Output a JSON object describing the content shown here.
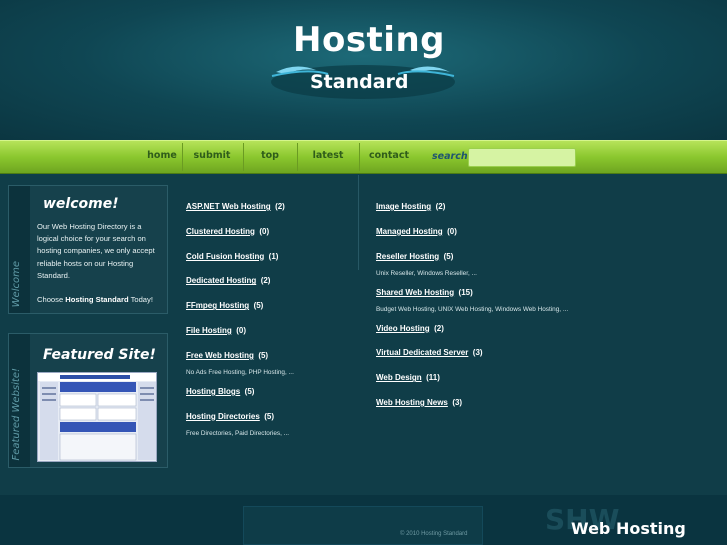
{
  "header": {
    "logo_title": "Hosting",
    "logo_subtitle": "Standard"
  },
  "nav": {
    "items": [
      "home",
      "submit link",
      "top links",
      "latest links",
      "contact us"
    ],
    "search_label": "search",
    "search_value": ""
  },
  "sidebar": {
    "welcome": {
      "heading": "welcome!",
      "side_label": "Welcome",
      "text_before": "Our Web Hosting Directory is a logical choice for your search on hosting companies, we only accept reliable hosts on our Hosting Standard.",
      "choose_prefix": "Choose ",
      "choose_brand": "Hosting Standard",
      "choose_suffix": " Today!"
    },
    "featured": {
      "heading": "Featured Site!",
      "side_label": "Featured Website!"
    }
  },
  "directory": {
    "left": [
      {
        "name": "ASP.NET Web Hosting",
        "count": "(2)",
        "subs": ""
      },
      {
        "name": "Clustered Hosting",
        "count": "(0)",
        "subs": ""
      },
      {
        "name": "Cold Fusion Hosting",
        "count": "(1)",
        "subs": ""
      },
      {
        "name": "Dedicated Hosting",
        "count": "(2)",
        "subs": ""
      },
      {
        "name": "FFmpeg Hosting",
        "count": "(5)",
        "subs": ""
      },
      {
        "name": "File Hosting",
        "count": "(0)",
        "subs": ""
      },
      {
        "name": "Free Web Hosting",
        "count": "(5)",
        "subs": "No Ads Free Hosting, PHP Hosting, ..."
      },
      {
        "name": "Hosting Blogs",
        "count": "(5)",
        "subs": ""
      },
      {
        "name": "Hosting Directories",
        "count": "(5)",
        "subs": "Free Directories, Paid Directories, ..."
      }
    ],
    "right": [
      {
        "name": "Image Hosting",
        "count": "(2)",
        "subs": ""
      },
      {
        "name": "Managed Hosting",
        "count": "(0)",
        "subs": ""
      },
      {
        "name": "Reseller Hosting",
        "count": "(5)",
        "subs": "Unix Reseller, Windows Reseller, ..."
      },
      {
        "name": "Shared Web Hosting",
        "count": "(15)",
        "subs": "Budget Web Hosting, UNIX Web Hosting, Windows Web Hosting, ..."
      },
      {
        "name": "Video Hosting",
        "count": "(2)",
        "subs": ""
      },
      {
        "name": "Virtual Dedicated Server",
        "count": "(3)",
        "subs": ""
      },
      {
        "name": "Web Design",
        "count": "(11)",
        "subs": ""
      },
      {
        "name": "Web Hosting News",
        "count": "(3)",
        "subs": ""
      }
    ]
  },
  "footer": {
    "copyright": "© 2010 Hosting Standard",
    "brand": "Web Hosting"
  },
  "colors": {
    "background": "#0d3f4c",
    "nav_green": "#8bc72e",
    "nav_text": "#2f5d1a"
  }
}
